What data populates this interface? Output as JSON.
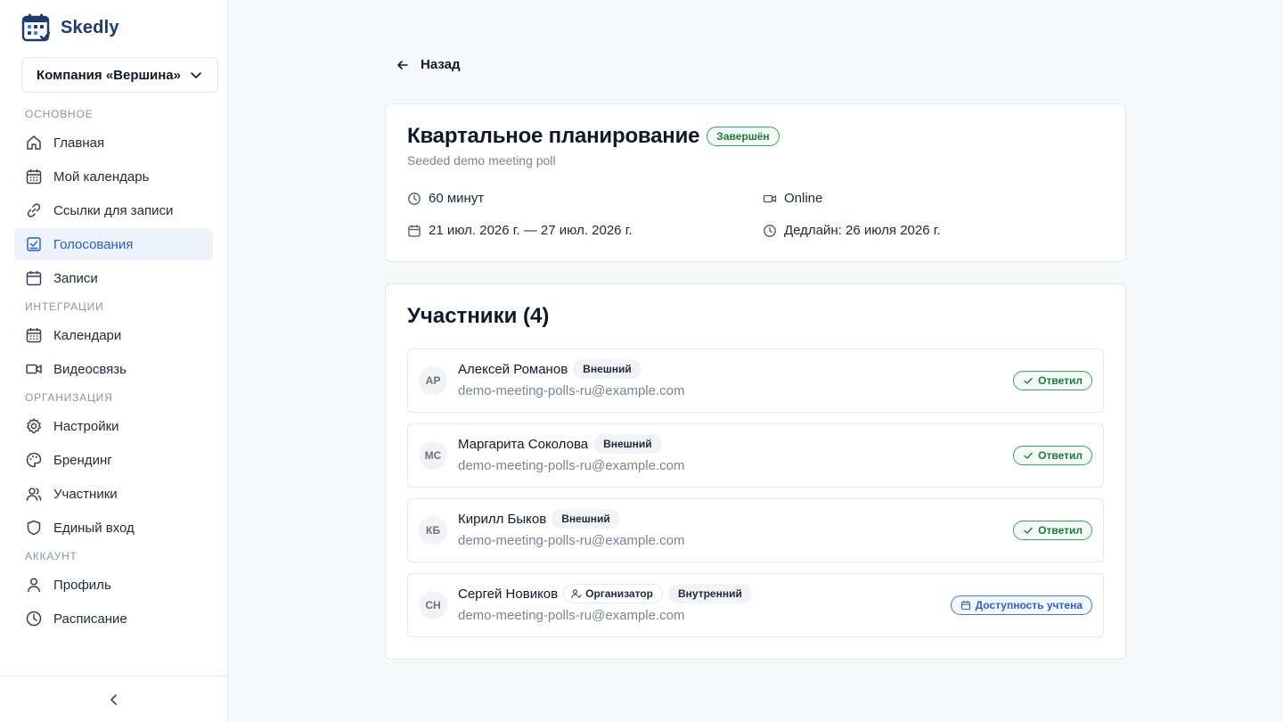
{
  "brand": {
    "name": "Skedly",
    "accent": "#1e3a6e"
  },
  "org": {
    "selected": "Компания «Вершина»"
  },
  "nav": {
    "sections": {
      "main": "Основное",
      "integrations": "Интеграции",
      "organization": "Организация",
      "account": "Аккаунт"
    },
    "items": {
      "home": "Главная",
      "calendar": "Мой календарь",
      "links": "Ссылки для записи",
      "polls": "Голосования",
      "bookings": "Записи",
      "calendars": "Календари",
      "video": "Видеосвязь",
      "settings": "Настройки",
      "branding": "Брендинг",
      "members": "Участники",
      "sso": "Единый вход",
      "profile": "Профиль",
      "schedule": "Расписание"
    },
    "active": "polls"
  },
  "back_label": "Назад",
  "poll": {
    "title": "Квартальное планирование",
    "status": "Завершён",
    "description": "Seeded demo meeting poll",
    "duration": "60 минут",
    "location": "Online",
    "date_range": "21 июл. 2026 г. — 27 июл. 2026 г.",
    "deadline": "Дедлайн: 26 июля 2026 г."
  },
  "participants": {
    "title": "Участники (4)",
    "list": [
      {
        "initials": "АР",
        "name": "Алексей Романов",
        "tag": "Внешний",
        "email": "demo-meeting-polls-ru@example.com",
        "status": "Ответил"
      },
      {
        "initials": "МС",
        "name": "Маргарита Соколова",
        "tag": "Внешний",
        "email": "demo-meeting-polls-ru@example.com",
        "status": "Ответил"
      },
      {
        "initials": "КБ",
        "name": "Кирилл Быков",
        "tag": "Внешний",
        "email": "demo-meeting-polls-ru@example.com",
        "status": "Ответил"
      },
      {
        "initials": "СН",
        "name": "Сергей Новиков",
        "role": "Организатор",
        "tag": "Внутренний",
        "email": "demo-meeting-polls-ru@example.com",
        "status": "Доступность учтена"
      }
    ]
  }
}
